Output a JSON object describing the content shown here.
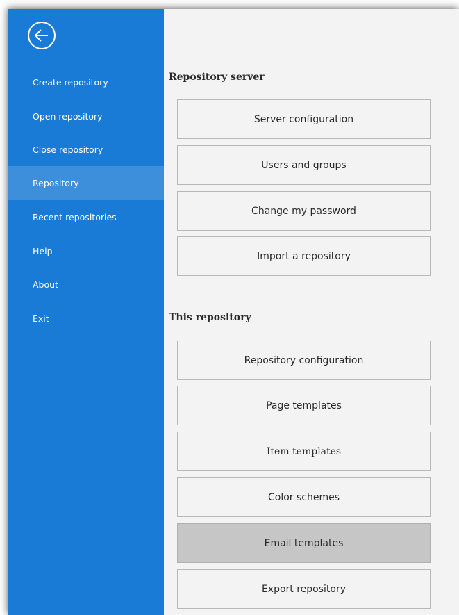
{
  "sidebar": {
    "back_icon": "circle-arrow-left-icon",
    "items": [
      {
        "label": "Create repository",
        "active": false
      },
      {
        "label": "Open repository",
        "active": false
      },
      {
        "label": "Close repository",
        "active": false
      },
      {
        "label": "Repository",
        "active": true
      },
      {
        "label": "Recent repositories",
        "active": false
      },
      {
        "label": "Help",
        "active": false
      },
      {
        "label": "About",
        "active": false
      },
      {
        "label": "Exit",
        "active": false
      }
    ]
  },
  "main": {
    "repository_server": {
      "title": "Repository server",
      "buttons": [
        "Server configuration",
        "Users and groups",
        "Change my password",
        "Import a repository"
      ]
    },
    "this_repository": {
      "title": "This repository",
      "buttons": [
        "Repository configuration",
        "Page templates",
        "Item templates",
        "Color schemes",
        "Email templates",
        "Export repository"
      ],
      "hovered_button": "Email templates"
    }
  },
  "colors": {
    "sidebar_bg": "#1a7bd6",
    "sidebar_active": "#3d8fdc",
    "content_bg": "#f3f3f3",
    "button_hover": "#c6c6c6"
  }
}
